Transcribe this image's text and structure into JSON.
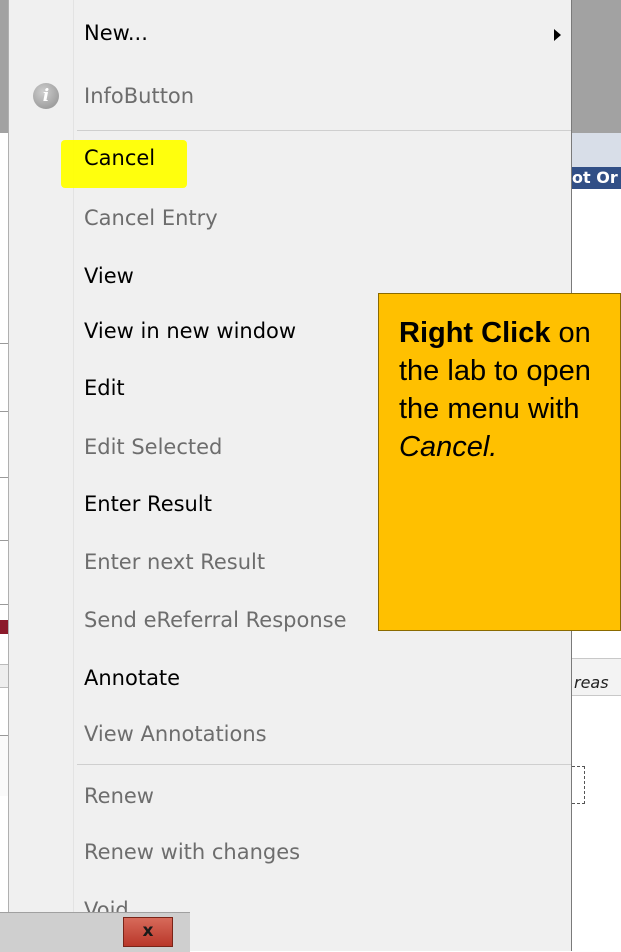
{
  "background": {
    "right_header_fragment": "ot Or",
    "right_filter_fragment": "reas"
  },
  "menu": {
    "items": [
      {
        "label": "New...",
        "enabled": true,
        "has_submenu": true
      },
      {
        "label": "InfoButton",
        "enabled": false,
        "icon": "info-icon"
      },
      {
        "label": "Cancel",
        "enabled": true,
        "highlighted": true
      },
      {
        "label": "Cancel Entry",
        "enabled": false
      },
      {
        "label": "View",
        "enabled": true
      },
      {
        "label": "View in new window",
        "enabled": true
      },
      {
        "label": "Edit",
        "enabled": true
      },
      {
        "label": "Edit Selected",
        "enabled": false
      },
      {
        "label": "Enter Result",
        "enabled": true
      },
      {
        "label": "Enter next Result",
        "enabled": false
      },
      {
        "label": "Send eReferral Response",
        "enabled": false
      },
      {
        "label": "Annotate",
        "enabled": true
      },
      {
        "label": "View Annotations",
        "enabled": false
      },
      {
        "label": "Renew",
        "enabled": false
      },
      {
        "label": "Renew with changes",
        "enabled": false
      },
      {
        "label": "Void",
        "enabled": false
      }
    ]
  },
  "callout": {
    "bold": "Right Click",
    "middle": " on the lab to open the menu with ",
    "italic": "Cancel."
  },
  "window": {
    "close_label": "x"
  },
  "colors": {
    "highlight": "#ffff00",
    "callout_bg": "#ffc000",
    "header_blue": "#314f86",
    "close_red": "#c0392b"
  }
}
